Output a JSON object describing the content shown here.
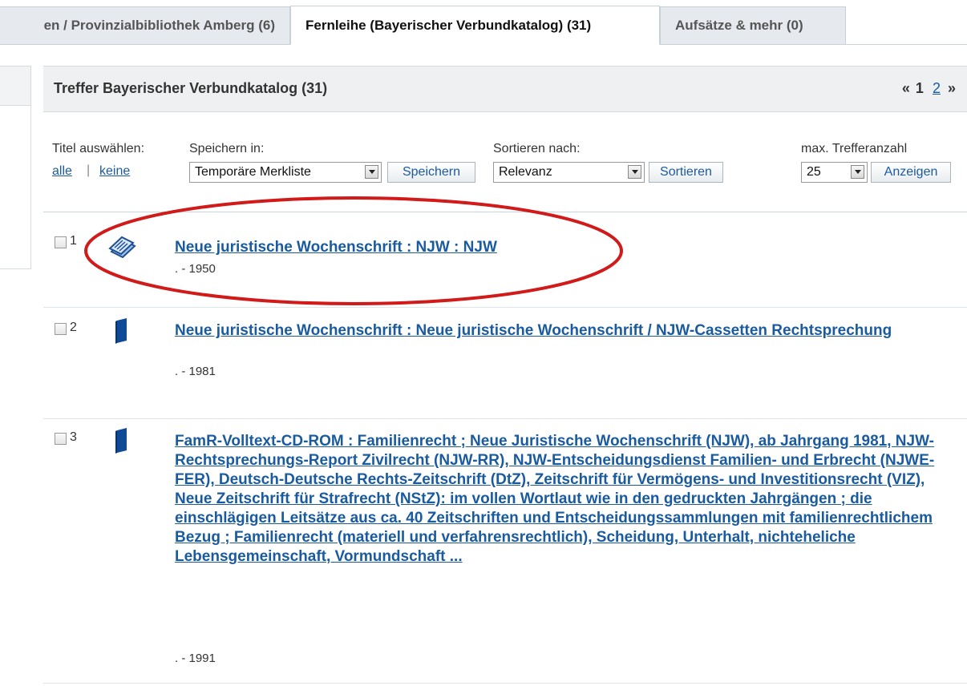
{
  "tabs": [
    {
      "label": "en / Provinzialbibliothek Amberg (6)"
    },
    {
      "label": "Fernleihe (Bayerischer Verbundkatalog) (31)"
    },
    {
      "label": "Aufsätze & mehr (0)"
    }
  ],
  "results_header": {
    "title": "Treffer Bayerischer Verbundkatalog (31)",
    "pager": {
      "prev": "«",
      "current": "1",
      "page2": "2",
      "next": "»"
    }
  },
  "toolbar": {
    "select_titles_label": "Titel auswählen:",
    "all_link": "alle",
    "separator": "|",
    "none_link": "keine",
    "save_in_label": "Speichern in:",
    "save_in_value": "Temporäre Merkliste",
    "save_button": "Speichern",
    "sort_by_label": "Sortieren nach:",
    "sort_by_value": "Relevanz",
    "sort_button": "Sortieren",
    "max_hits_label": "max. Trefferanzahl",
    "max_hits_value": "25",
    "show_button": "Anzeigen"
  },
  "results": [
    {
      "number": "1",
      "media_icon": "journal-icon",
      "title": "Neue juristische Wochenschrift : NJW : NJW",
      "year": ". - 1950"
    },
    {
      "number": "2",
      "media_icon": "book-icon",
      "title": "Neue juristische Wochenschrift : Neue juristische Wochenschrift / NJW-Cassetten Rechtsprechung",
      "year": ". - 1981"
    },
    {
      "number": "3",
      "media_icon": "book-icon",
      "title": "FamR-Volltext-CD-ROM : Familienrecht ; Neue Juristische Wochenschrift (NJW), ab Jahrgang 1981, NJW-Rechtsprechungs-Report Zivilrecht (NJW-RR), NJW-Entscheidungsdienst Familien- und Erbrecht (NJWE-FER), Deutsch-Deutsche Rechts-Zeitschrift (DtZ), Zeitschrift für Vermögens- und Investitionsrecht (VIZ), Neue Zeitschrift für Strafrecht (NStZ): im vollen Wortlaut wie in den gedruckten Jahrgängen ; die einschlägigen Leitsätze aus ca. 40 Zeitschriften und Entscheidungssammlungen mit familienrechtlichem Bezug ; Familienrecht (materiell und verfahrensrechtlich), Scheidung, Unterhalt, nichteheliche Lebensgemeinschaft, Vormundschaft ...",
      "year": ". - 1991"
    }
  ],
  "colors": {
    "link": "#1a5a9e",
    "highlight_ellipse": "#d11a1a",
    "header_bg": "#eef0f2"
  }
}
